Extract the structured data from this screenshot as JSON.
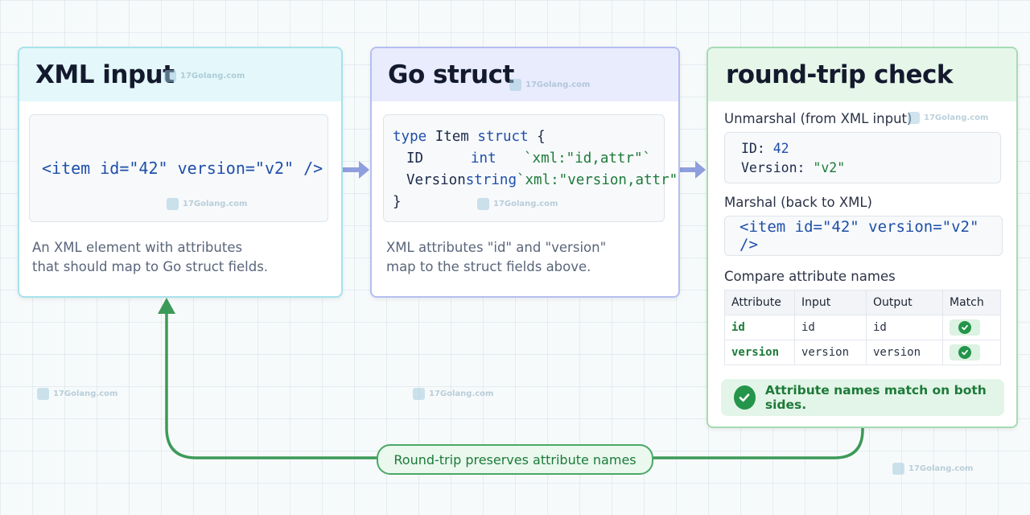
{
  "xml_input": {
    "title": "XML input",
    "code": "<item id=\"42\" version=\"v2\" />",
    "description_lines": [
      "An XML element with attributes",
      "that should map to Go struct fields."
    ]
  },
  "go_struct": {
    "title": "Go struct",
    "code": {
      "keyword_type": "type",
      "type_name": "Item",
      "keyword_struct": "struct",
      "open_brace": "{",
      "close_brace": "}",
      "fields": [
        {
          "name": "ID",
          "type": "int",
          "tag": "`xml:\"id,attr\"`"
        },
        {
          "name": "Version",
          "type": "string",
          "tag": "`xml:\"version,attr\"`"
        }
      ]
    },
    "description_lines": [
      "XML attributes \"id\" and \"version\"",
      "map to the struct fields above."
    ]
  },
  "round_trip": {
    "title": "round-trip check",
    "unmarshal_label": "Unmarshal (from XML input)",
    "unmarshal_values": [
      {
        "key": "ID:",
        "value": "42"
      },
      {
        "key": "Version:",
        "value": "\"v2\""
      }
    ],
    "marshal_label": "Marshal (back to XML)",
    "marshal_code": "<item id=\"42\" version=\"v2\" />",
    "compare_label": "Compare attribute names",
    "table": {
      "headers": [
        "Attribute",
        "Input",
        "Output",
        "Match"
      ],
      "rows": [
        {
          "attribute": "id",
          "input": "id",
          "output": "id",
          "match": true
        },
        {
          "attribute": "version",
          "input": "version",
          "output": "version",
          "match": true
        }
      ]
    },
    "banner": "Attribute names match on both sides."
  },
  "loop_label": "Round-trip preserves attribute names",
  "watermark": "17Golang.com",
  "colors": {
    "xml_accent": "#a6e2ec",
    "go_accent": "#b5bef0",
    "check_accent": "#a5dcb3",
    "arrow_blue": "#8f9edc",
    "loop_green": "#3c9a58"
  },
  "icons": [
    "arrow-right-icon",
    "check-icon",
    "arrow-up-icon"
  ]
}
